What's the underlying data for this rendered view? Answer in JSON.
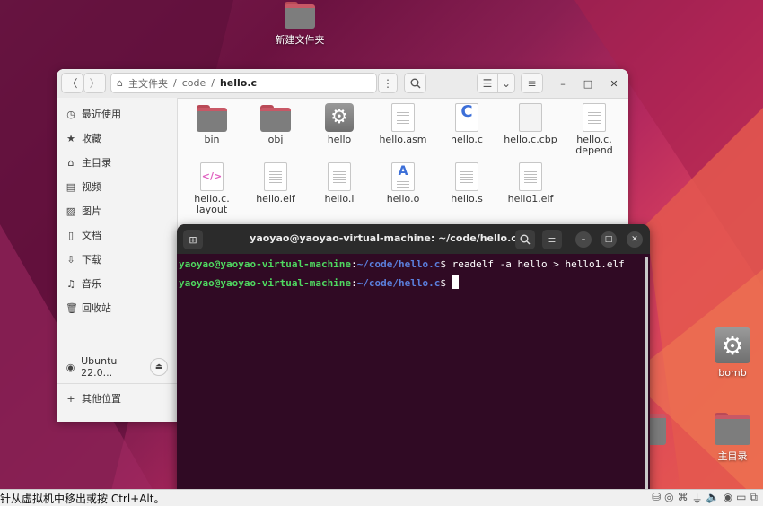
{
  "desktop": {
    "icons": [
      {
        "label": "新建文件夹",
        "name": "desktop-new-folder"
      },
      {
        "label": "bomb",
        "name": "desktop-bomb"
      },
      {
        "label": "主目录",
        "name": "desktop-home"
      }
    ]
  },
  "file_manager": {
    "breadcrumb": [
      "主文件夹",
      "code",
      "hello.c"
    ],
    "sidebar": [
      {
        "label": "最近使用",
        "icon": "clock-icon"
      },
      {
        "label": "收藏",
        "icon": "star-icon"
      },
      {
        "label": "主目录",
        "icon": "home-icon"
      },
      {
        "label": "视频",
        "icon": "video-icon"
      },
      {
        "label": "图片",
        "icon": "picture-icon"
      },
      {
        "label": "文档",
        "icon": "document-icon"
      },
      {
        "label": "下载",
        "icon": "download-icon"
      },
      {
        "label": "音乐",
        "icon": "music-icon"
      },
      {
        "label": "回收站",
        "icon": "trash-icon"
      },
      {
        "label": "Ubuntu 22.0...",
        "icon": "disc-icon"
      },
      {
        "label": "其他位置",
        "icon": "plus-icon"
      }
    ],
    "files": [
      {
        "name": "bin",
        "type": "folder"
      },
      {
        "name": "obj",
        "type": "folder"
      },
      {
        "name": "hello",
        "type": "executable"
      },
      {
        "name": "hello.asm",
        "type": "text"
      },
      {
        "name": "hello.c",
        "type": "c-source"
      },
      {
        "name": "hello.c.cbp",
        "type": "blank"
      },
      {
        "name": "hello.c.\ndepend",
        "type": "text"
      },
      {
        "name": "hello.c.\nlayout",
        "type": "xml"
      },
      {
        "name": "hello.elf",
        "type": "text"
      },
      {
        "name": "hello.i",
        "type": "text"
      },
      {
        "name": "hello.o",
        "type": "object"
      },
      {
        "name": "hello.s",
        "type": "text"
      },
      {
        "name": "hello1.elf",
        "type": "text"
      }
    ]
  },
  "terminal": {
    "title": "yaoyao@yaoyao-virtual-machine: ~/code/hello.c",
    "lines": [
      {
        "user": "yaoyao@yaoyao-virtual-machine",
        "sep": ":",
        "path": "~/code/hello.c",
        "cmd": "$ readelf -a hello > hello1.elf"
      },
      {
        "user": "yaoyao@yaoyao-virtual-machine",
        "sep": ":",
        "path": "~/code/hello.c",
        "cmd": "$ "
      }
    ]
  },
  "status_bar": {
    "message": "针从虚拟机中移出或按 Ctrl+Alt。"
  }
}
